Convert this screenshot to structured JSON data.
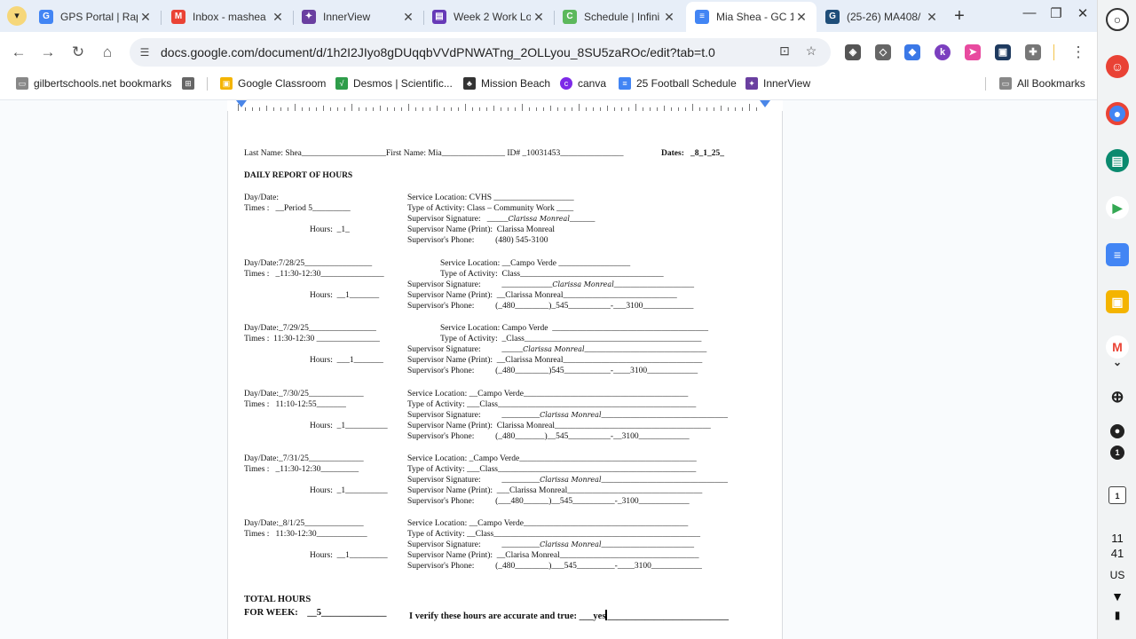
{
  "tabs": [
    {
      "title": "GPS Portal | Rap",
      "icon": "google-g-icon",
      "color": "#4285f4",
      "letter": "G"
    },
    {
      "title": "Inbox - mashea",
      "icon": "gmail-icon",
      "color": "#ea4335",
      "letter": "M"
    },
    {
      "title": "InnerView",
      "icon": "innerview-icon",
      "color": "#6a3fa0",
      "letter": "✦"
    },
    {
      "title": "Week 2 Work Lo",
      "icon": "classroom-form-icon",
      "color": "#673ab7",
      "letter": "▤"
    },
    {
      "title": "Schedule | Infini",
      "icon": "infinite-campus-icon",
      "color": "#5cb85c",
      "letter": "C"
    },
    {
      "title": "Mia Shea - GC 1",
      "icon": "google-docs-icon",
      "color": "#4285f4",
      "letter": "≡"
    },
    {
      "title": "(25-26) MA408/",
      "icon": "ga-icon",
      "color": "#1f4e79",
      "letter": "G"
    }
  ],
  "url": "docs.google.com/document/d/1h2I2JIyo8gDUqqbVVdPNWATng_2OLLyou_8SU5zaROc/edit?tab=t.0",
  "bookmarks": {
    "folder": "gilbertschools.net bookmarks",
    "items": [
      "Google Classroom",
      "Desmos | Scientific...",
      "Mission Beach",
      "canva",
      "25 Football Schedule",
      "InnerView"
    ],
    "all": "All Bookmarks"
  },
  "doc": {
    "header_line": "Last Name: Shea____________________First Name: Mia_______________ ID# _10031453_______________",
    "dates_label": "Dates:   _8_1_25_",
    "report_title": "DAILY REPORT OF HOURS",
    "entries": [
      {
        "left1": "Day/Date:",
        "left2": "Times :   __Period 5_________",
        "hours": "Hours:  _1_",
        "loc": "Service Location: CVHS ___________________",
        "type": "Type of Activity: Class – Community Work ____",
        "sig_label": "Supervisor Signature:   _____",
        "sig": "Clarissa Monreal",
        "sig_tail": "______",
        "name": "Supervisor Name (Print):  Clarissa Monreal",
        "phone": "Supervisor's Phone:          (480) 545-3100"
      },
      {
        "left1": "Day/Date:7/28/25________________",
        "left2": "Times :   _11:30-12:30_______________",
        "hours": "Hours:  __1_______",
        "loc": "Service Location: __Campo Verde _________________",
        "type": "Type of Activity:  Class__________________________________",
        "sig_label": "Supervisor Signature:          ____________",
        "sig": "Clarissa Monreal",
        "sig_tail": "___________________",
        "name": "Supervisor Name (Print):  __Clarissa Monreal___________________________",
        "phone": "Supervisor's Phone:          (_480________)_545__________-___3100____________"
      },
      {
        "left1": "Day/Date:_7/29/25________________",
        "left2": "Times :  11:30-12:30 _______________",
        "hours": "Hours:  ___1_______",
        "loc": "Service Location: Campo Verde  _____________________________________",
        "type": "Type of Activity:  _Class__________________________________________",
        "sig_label": "Supervisor Signature:          _____",
        "sig": "Clarissa Monreal",
        "sig_tail": "_____________________________",
        "name": "Supervisor Name (Print):  __Clarissa Monreal_________________________________",
        "phone": "Supervisor's Phone:          (_480________)545___________-____3100____________"
      },
      {
        "left1": "Day/Date:_7/30/25_____________",
        "left2": "Times :   11:10-12:55_______",
        "hours": "Hours:  _1__________",
        "loc": "Service Location: __Campo Verde_______________________________________",
        "type": "Type of Activity: ___Class_______________________________________________",
        "sig_label": "Supervisor Signature:          _________",
        "sig": "Clarissa Monreal",
        "sig_tail": "______________________________",
        "name": "Supervisor Name (Print):  Clarissa Monreal_____________________________________",
        "phone": "Supervisor's Phone:          (_480_______)__545__________-__3100____________"
      },
      {
        "left1": "Day/Date:_7/31/25_____________",
        "left2": "Times :   _11:30-12:30_________",
        "hours": "Hours:  _1__________",
        "loc": "Service Location: _Campo Verde__________________________________________",
        "type": "Type of Activity: ___Class_______________________________________________",
        "sig_label": "Supervisor Signature:          _________",
        "sig": "Clarissa Monreal",
        "sig_tail": "______________________________",
        "name": "Supervisor Name (Print):  ___Clarissa Monreal________________________________",
        "phone": "Supervisor's Phone:          (___480______)__545__________-_3100____________"
      },
      {
        "left1": "Day/Date:_8/1/25______________",
        "left2": "Times :   11:30-12:30____________",
        "hours": "Hours:  __1_________",
        "loc": "Service Location: __Campo Verde_______________________________________",
        "type": "Type of Activity: __Class_________________________________________________",
        "sig_label": "Supervisor Signature:          _________",
        "sig": "Clarissa Monreal",
        "sig_tail": "______________________",
        "name": "Supervisor Name (Print):  __Clarisa Monreal_________________________________",
        "phone": "Supervisor's Phone:          (_480________)___545_________-____3100____________"
      }
    ],
    "total_label1": "TOTAL HOURS",
    "total_label2": "FOR WEEK:    __5______________",
    "verify": "I verify these hours are accurate and true: ___yes",
    "verify_tail": "__________________________"
  },
  "shelf": {
    "time_h": "11",
    "time_m": "41",
    "locale": "US",
    "badge": "1",
    "cal_day": "1"
  }
}
